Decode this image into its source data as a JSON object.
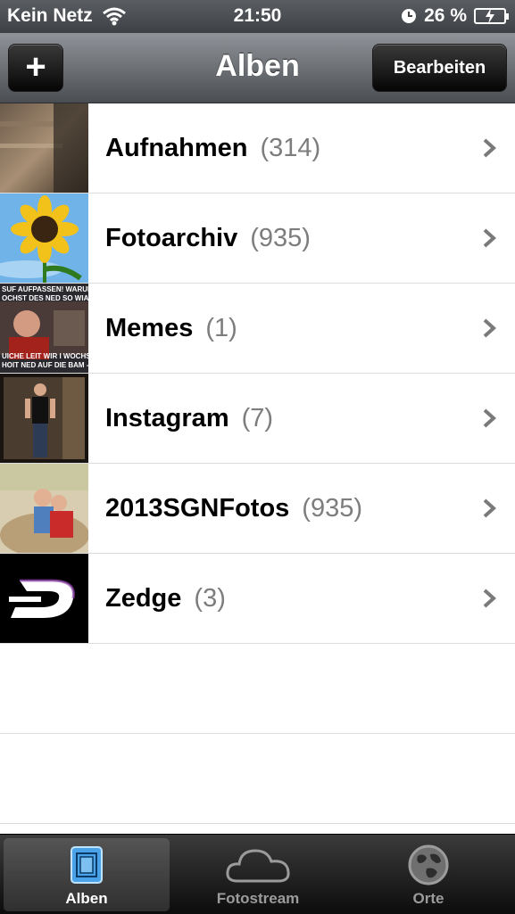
{
  "status_bar": {
    "carrier": "Kein Netz",
    "time": "21:50",
    "battery": "26 %"
  },
  "nav": {
    "title": "Alben",
    "add_label": "+",
    "edit_label": "Bearbeiten"
  },
  "albums": [
    {
      "name": "Aufnahmen",
      "count": "(314)"
    },
    {
      "name": "Fotoarchiv",
      "count": "(935)"
    },
    {
      "name": "Memes",
      "count": "(1)"
    },
    {
      "name": "Instagram",
      "count": "(7)"
    },
    {
      "name": "2013SGNFotos",
      "count": "(935)"
    },
    {
      "name": "Zedge",
      "count": "(3)"
    }
  ],
  "memes_thumb": {
    "top": "SUF AUFPASSEN! WARUM",
    "top2": "OCHST DES NED SO WIA",
    "bottom": "UICHE LEIT WIR I WOCHS",
    "bottom2": "HOIT NED AUF DIE BAM -"
  },
  "tabs": [
    {
      "label": "Alben",
      "icon": "albums-icon",
      "active": true
    },
    {
      "label": "Fotostream",
      "icon": "cloud-icon",
      "active": false
    },
    {
      "label": "Orte",
      "icon": "globe-icon",
      "active": false
    }
  ],
  "colors": {
    "count_gray": "#7d7d7d",
    "tab_active_blue": "#4aa3e8"
  }
}
